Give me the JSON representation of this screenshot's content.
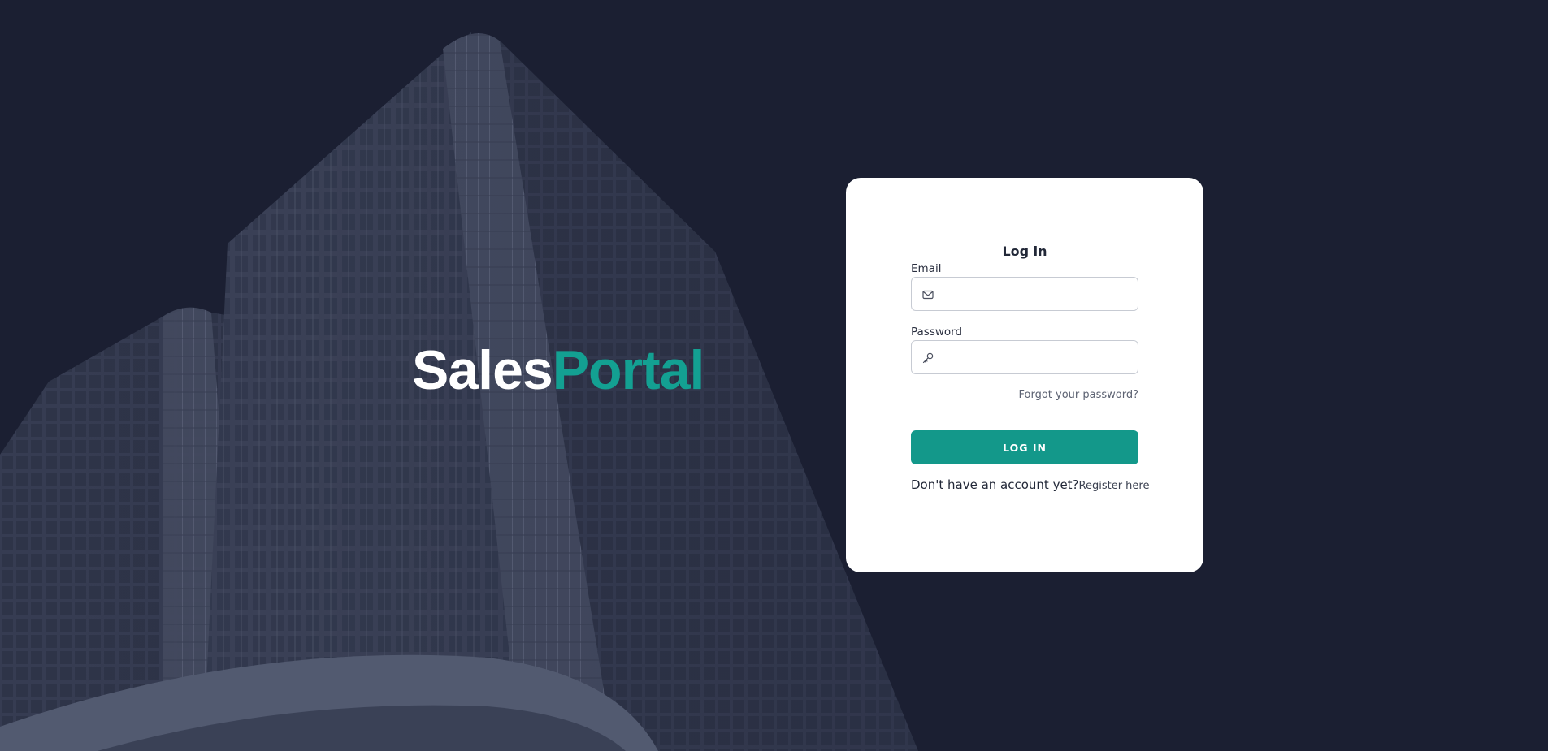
{
  "brand": {
    "logo_part1": "Sales",
    "logo_part2": "Portal",
    "accent_color": "#13a092",
    "background_color": "#1b1f32"
  },
  "login_form": {
    "title": "Log in",
    "email_label": "Email",
    "email_value": "",
    "email_icon": "mail-icon",
    "password_label": "Password",
    "password_value": "",
    "password_icon": "key-icon",
    "forgot_password_link": "Forgot your password?",
    "submit_label": "LOG IN",
    "no_account_text": "Don't have an account yet?",
    "register_link": "Register here"
  }
}
